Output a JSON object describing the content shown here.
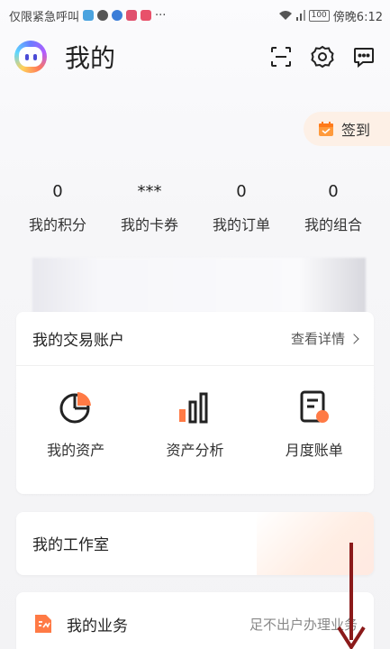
{
  "status_bar": {
    "left_text": "仅限紧急呼叫",
    "more": "···",
    "battery": "100",
    "carrier_time": "傍晚6:12"
  },
  "header": {
    "title": "我的"
  },
  "checkin": {
    "label": "签到"
  },
  "stats": [
    {
      "value": "0",
      "label": "我的积分"
    },
    {
      "value": "***",
      "label": "我的卡券"
    },
    {
      "value": "0",
      "label": "我的订单"
    },
    {
      "value": "0",
      "label": "我的组合"
    }
  ],
  "trade_card": {
    "title": "我的交易账户",
    "link": "查看详情",
    "items": [
      {
        "label": "我的资产"
      },
      {
        "label": "资产分析"
      },
      {
        "label": "月度账单"
      }
    ]
  },
  "studio_card": {
    "title": "我的工作室"
  },
  "business_card": {
    "title": "我的业务",
    "desc": "足不出户办理业务"
  },
  "colors": {
    "accent": "#ff7a45",
    "arrow": "#8b1a1a"
  }
}
